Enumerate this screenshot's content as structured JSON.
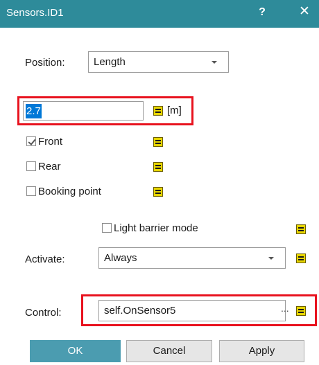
{
  "window": {
    "title": "Sensors.ID1",
    "help_label": "?",
    "close_label": "✕"
  },
  "position": {
    "label": "Position:",
    "value": "Length"
  },
  "length": {
    "value": "2.7",
    "unit": "[m]"
  },
  "options": {
    "front": {
      "label": "Front",
      "checked": true
    },
    "rear": {
      "label": "Rear",
      "checked": false
    },
    "booking_point": {
      "label": "Booking point",
      "checked": false
    },
    "light_barrier": {
      "label": "Light barrier mode",
      "checked": false
    }
  },
  "activate": {
    "label": "Activate:",
    "value": "Always"
  },
  "control": {
    "label": "Control:",
    "value": "self.OnSensor5",
    "browse_label": "..."
  },
  "buttons": {
    "ok": "OK",
    "cancel": "Cancel",
    "apply": "Apply"
  },
  "icons": {
    "equals": "formula-icon",
    "help": "help-icon",
    "close": "close-icon"
  },
  "colors": {
    "titlebar": "#2e8b9a",
    "highlight": "#e8121e",
    "selection": "#0078d7",
    "icon_yellow": "#e8d600",
    "ok_button": "#4b9cb0"
  }
}
